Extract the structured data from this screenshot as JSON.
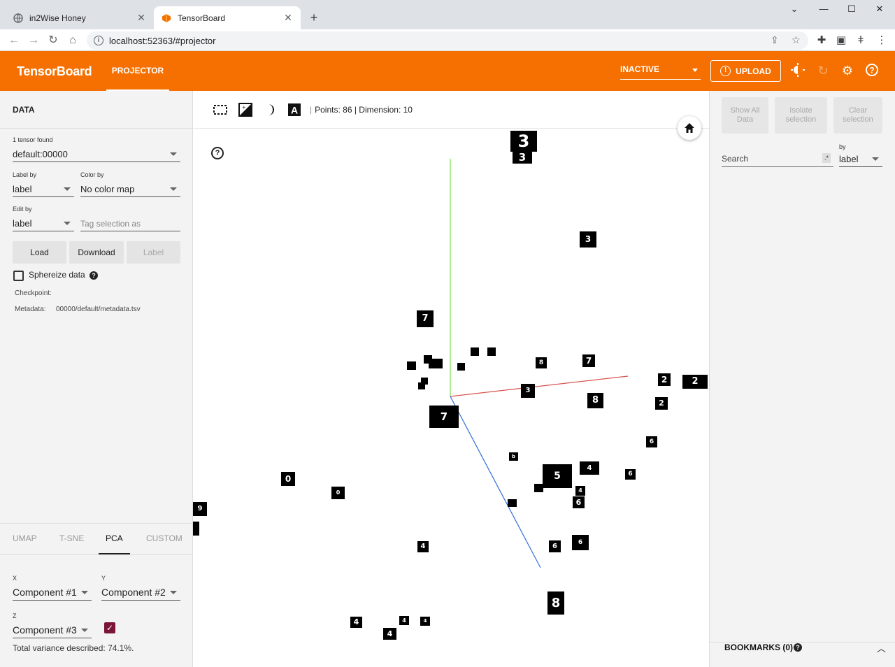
{
  "browser": {
    "tabs": [
      {
        "label": "in2Wise Honey",
        "active": false
      },
      {
        "label": "TensorBoard",
        "active": true
      }
    ],
    "url": "localhost:52363/#projector"
  },
  "header": {
    "brand": "TensorBoard",
    "tab": "PROJECTOR",
    "run_status": "INACTIVE",
    "upload_label": "UPLOAD",
    "color": "#f57000"
  },
  "left": {
    "section_title": "DATA",
    "tensor_found": "1 tensor found",
    "tensor_value": "default:00000",
    "label_by_label": "Label by",
    "label_by_value": "label",
    "color_by_label": "Color by",
    "color_by_value": "No color map",
    "edit_by_label": "Edit by",
    "edit_by_value": "label",
    "tag_placeholder": "Tag selection as",
    "load_label": "Load",
    "download_label": "Download",
    "label_btn": "Label",
    "sphereize_label": "Sphereize data",
    "checkpoint_label": "Checkpoint:",
    "metadata_label": "Metadata:",
    "metadata_value": "00000/default/metadata.tsv",
    "projection_tabs": [
      "UMAP",
      "T-SNE",
      "PCA",
      "CUSTOM"
    ],
    "active_projection": "PCA",
    "x_axis_label": "X",
    "x_axis_value": "Component #1",
    "y_axis_label": "Y",
    "y_axis_value": "Component #2",
    "z_axis_label": "Z",
    "z_axis_value": "Component #3",
    "z_enabled": true,
    "variance_text": "Total variance described: 74.1%."
  },
  "canvas": {
    "stats": "Points: 86 | Dimension: 10",
    "points": [
      {
        "d": "3"
      },
      {
        "d": "3"
      },
      {
        "d": "3"
      },
      {
        "d": "7"
      },
      {
        "d": "7"
      },
      {
        "d": "8"
      },
      {
        "d": "3"
      },
      {
        "d": "8"
      },
      {
        "d": "2"
      },
      {
        "d": "2"
      },
      {
        "d": "5"
      },
      {
        "d": "2"
      },
      {
        "d": "6"
      },
      {
        "d": "0"
      },
      {
        "d": "0"
      },
      {
        "d": "7"
      },
      {
        "d": "0"
      },
      {
        "d": "5"
      },
      {
        "d": "5"
      },
      {
        "d": "4"
      },
      {
        "d": "6"
      },
      {
        "d": "6"
      },
      {
        "d": "6"
      },
      {
        "d": "4"
      },
      {
        "d": "8"
      },
      {
        "d": "4"
      },
      {
        "d": "4"
      },
      {
        "d": "4"
      },
      {
        "d": "4"
      },
      {
        "d": "9"
      },
      {
        "d": "6"
      },
      {
        "d": "4"
      },
      {
        "d": "b"
      }
    ]
  },
  "right": {
    "show_all": "Show All Data",
    "isolate": "Isolate selection",
    "clear": "Clear selection",
    "search_placeholder": "Search",
    "regex": ".*",
    "by_label": "by",
    "by_value": "label",
    "bookmarks": "BOOKMARKS (0)"
  }
}
